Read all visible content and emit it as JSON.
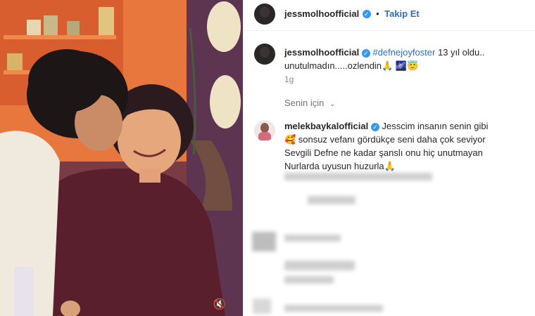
{
  "post": {
    "username": "jessmolhoofficial",
    "follow_label": "Takip Et",
    "caption_hashtag": "#defnejoyfoster",
    "caption_text": " 13 yıl oldu..",
    "caption_line2": "unutulmadın.....ozlendin🙏 🌌😇",
    "time_ago": "1g",
    "sort_label": "Senin için"
  },
  "comment": {
    "username": "melekbaykalofficial",
    "line1": " Jesscim insanın senin gibi",
    "line2": "🥰 sonsuz vefanı gördükçe seni daha çok seviyor",
    "line3": "Sevgili Defne ne kadar şanslı onu hiç unutmayan",
    "line4": "Nurlarda uyusun huzurla🙏"
  },
  "icons": {
    "verified": "verified-badge-icon",
    "chevron": "chevron-down-icon",
    "mute": "mute-icon"
  },
  "colors": {
    "link_blue": "#2f6db3",
    "verified_blue": "#3797f0",
    "wall_orange": "#e8773e",
    "wall_purple": "#5d3550"
  }
}
